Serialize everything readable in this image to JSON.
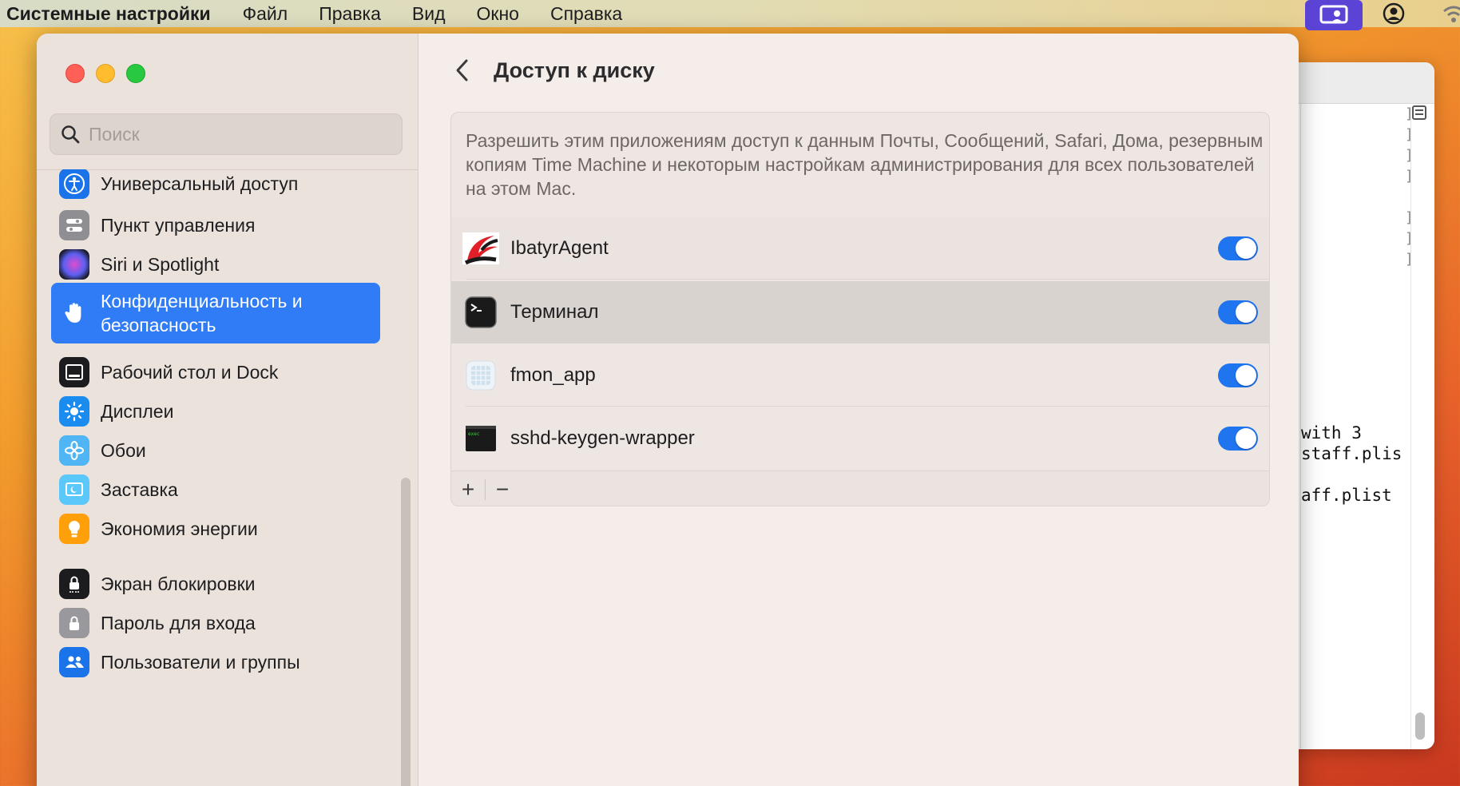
{
  "menubar": {
    "app_name": "Системные настройки",
    "items": [
      "Файл",
      "Правка",
      "Вид",
      "Окно",
      "Справка"
    ]
  },
  "background_window": {
    "lines": [
      "with 3",
      "staff.plis",
      "aff.plist"
    ]
  },
  "sidebar": {
    "search_placeholder": "Поиск",
    "items": [
      {
        "label": "Универсальный доступ",
        "icon": "accessibility-icon"
      },
      {
        "label": "Пункт управления",
        "icon": "control-center-icon"
      },
      {
        "label": "Siri и Spotlight",
        "icon": "siri-icon"
      },
      {
        "label": "Конфиденциальность и\nбезопасность",
        "icon": "privacy-hand-icon",
        "selected": true
      },
      {
        "label": "Рабочий стол и Dock",
        "icon": "desktop-dock-icon"
      },
      {
        "label": "Дисплеи",
        "icon": "displays-icon"
      },
      {
        "label": "Обои",
        "icon": "wallpaper-icon"
      },
      {
        "label": "Заставка",
        "icon": "screensaver-icon"
      },
      {
        "label": "Экономия энергии",
        "icon": "energy-saver-icon"
      },
      {
        "label": "Экран блокировки",
        "icon": "lock-screen-icon"
      },
      {
        "label": "Пароль для входа",
        "icon": "login-password-icon"
      },
      {
        "label": "Пользователи и группы",
        "icon": "users-groups-icon"
      }
    ]
  },
  "main": {
    "title": "Доступ к диску",
    "description": "Разрешить этим приложениям доступ к данным Почты, Сообщений, Safari, Дома, резервным копиям Time Machine и некоторым настройкам администрирования для всех пользователей на этом Mac.",
    "apps": [
      {
        "name": "IbatyrAgent",
        "enabled": true,
        "icon": "ibatyr-agent-icon"
      },
      {
        "name": "Терминал",
        "enabled": true,
        "icon": "terminal-icon"
      },
      {
        "name": "fmon_app",
        "enabled": true,
        "icon": "fmon-app-icon"
      },
      {
        "name": "sshd-keygen-wrapper",
        "enabled": true,
        "icon": "exec-icon"
      }
    ],
    "add_label": "+",
    "remove_label": "−"
  },
  "colors": {
    "accent": "#2f7cf6",
    "toggle_on": "#1f74f0"
  }
}
